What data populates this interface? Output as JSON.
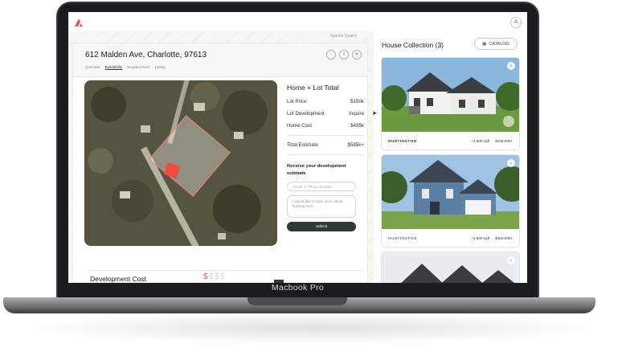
{
  "device": {
    "brand_label": "Macbook Pro"
  },
  "app": {
    "user_initial": "A",
    "map_label": "Granite Quarry"
  },
  "property": {
    "address": "612 Malden Ave, Charlotte, 97613",
    "tabs": [
      "Overview",
      "Buildability",
      "Neighborhood",
      "Listing"
    ],
    "active_tab": "Buildability"
  },
  "pricing": {
    "title": "Home + Lot Total",
    "rows": [
      {
        "label": "Lot Price",
        "value": "$150k"
      },
      {
        "label": "Lot Development",
        "value": "Inquire"
      },
      {
        "label": "Home Cost",
        "value": "$435k"
      }
    ],
    "total": {
      "label": "Total Estimate",
      "value": "$585k+"
    }
  },
  "estimate_form": {
    "title": "Receive your development estimate",
    "contact_placeholder": "Email or Phone Number",
    "message_text": "I would like to learn more about building here...",
    "submit_label": "Submit"
  },
  "development": {
    "title": "Development Cost",
    "dollars_on": "$",
    "dollars_off": "$$$"
  },
  "collection": {
    "title": "House Collection (3)",
    "catalog_label": "CATALOG",
    "houses": [
      {
        "name": "HUNTINGTON",
        "sqft": "~2,500 sqft",
        "price": "$435,000+"
      },
      {
        "name": "HUNTINGTON",
        "sqft": "~2,500 sqft",
        "price": "$450,000+"
      }
    ]
  },
  "colors": {
    "accent": "#e8574a",
    "dark_button": "#2d3b38"
  }
}
